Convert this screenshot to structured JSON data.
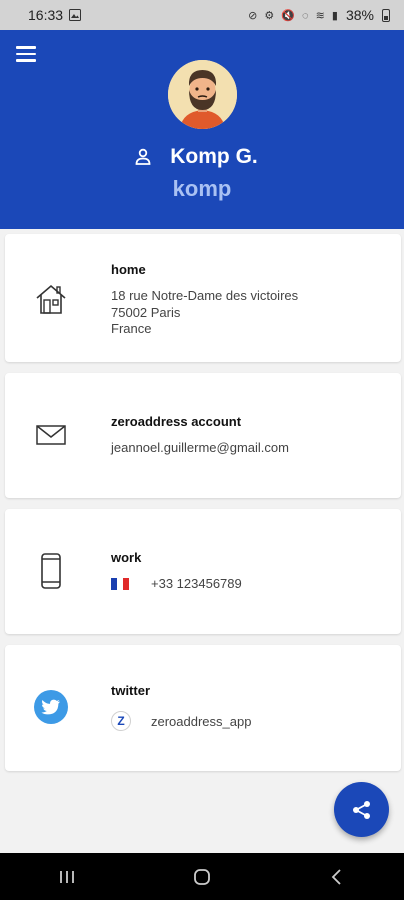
{
  "status_bar": {
    "time": "16:33",
    "battery": "38%",
    "icons": "⊘ ⚙ 🔇 ◌ ≋ ▮"
  },
  "header": {
    "name": "Komp G.",
    "username": "komp"
  },
  "cards": [
    {
      "icon": "house-icon",
      "title": "home",
      "lines": [
        "18 rue Notre-Dame des victoires",
        "75002 Paris",
        "France"
      ]
    },
    {
      "icon": "envelope-icon",
      "title": "zeroaddress account",
      "lines": [
        "jeannoel.guillerme@gmail.com"
      ]
    },
    {
      "icon": "phone-icon",
      "title": "work",
      "flag": "french-flag-icon",
      "value": "+33 123456789"
    },
    {
      "icon": "twitter-icon",
      "title": "twitter",
      "badge": "Z",
      "value": "zeroaddress_app"
    }
  ],
  "colors": {
    "primary": "#1b48b8",
    "username": "#a9c1f3",
    "twitter": "#3d9ae6"
  },
  "fab": {
    "icon": "share-icon"
  },
  "nav": {
    "items": [
      "recent-apps-icon",
      "home-icon",
      "back-icon"
    ]
  }
}
